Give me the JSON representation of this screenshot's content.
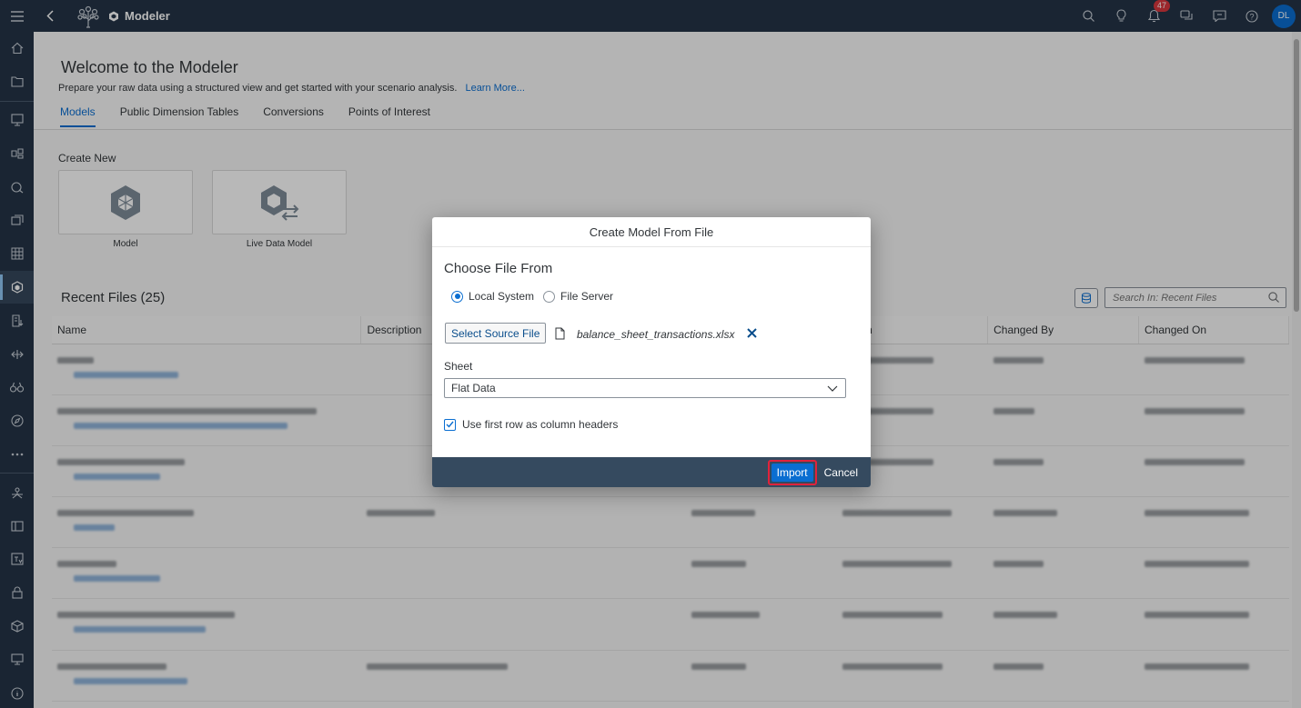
{
  "shell": {
    "app_title": "Modeler",
    "notification_count": "47",
    "avatar_initials": "DL"
  },
  "header": {
    "title": "Welcome to the Modeler",
    "subtitle": "Prepare your raw data using a structured view and get started with your scenario analysis.",
    "learn_more": "Learn More...",
    "tabs": [
      {
        "label": "Models",
        "active": true
      },
      {
        "label": "Public Dimension Tables",
        "active": false
      },
      {
        "label": "Conversions",
        "active": false
      },
      {
        "label": "Points of Interest",
        "active": false
      }
    ]
  },
  "create_new": {
    "label": "Create New",
    "tiles": [
      {
        "label": "Model",
        "icon": "model-cube-icon"
      },
      {
        "label": "Live Data Model",
        "icon": "live-data-model-icon"
      }
    ]
  },
  "recent": {
    "title": "Recent Files (25)",
    "search_placeholder": "Search In: Recent Files",
    "columns": [
      "Name",
      "Description",
      "",
      "ed On",
      "Changed By",
      "Changed On"
    ]
  },
  "dialog": {
    "title": "Create Model From File",
    "choose_label": "Choose File From",
    "radio_local": "Local System",
    "radio_server": "File Server",
    "select_button": "Select Source File",
    "filename": "balance_sheet_transactions.xlsx",
    "sheet_label": "Sheet",
    "sheet_value": "Flat Data",
    "checkbox_label": "Use first row as column headers",
    "import_button": "Import",
    "cancel_button": "Cancel"
  },
  "colors": {
    "shell_bg": "#243447",
    "accent": "#0a6ed1",
    "dialog_footer": "#354a5f",
    "highlight": "#e2223b"
  }
}
